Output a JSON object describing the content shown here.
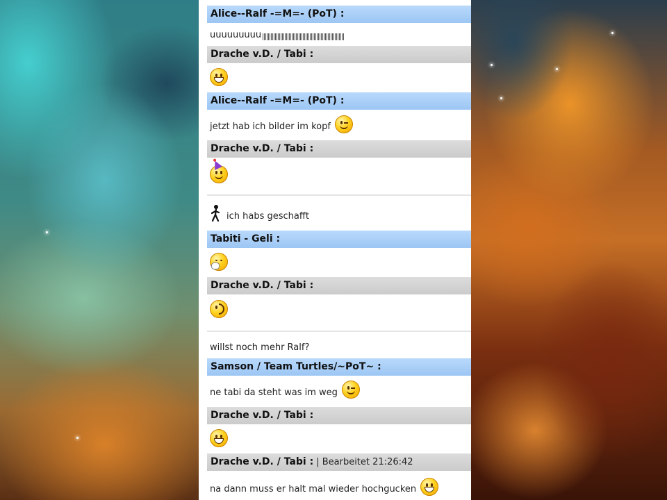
{
  "messages": [
    {
      "type": "header",
      "color": "blue",
      "author": "Alice--Ralf -=M=- (PoT) :"
    },
    {
      "type": "body",
      "text": "uuuuuuuuu"
    },
    {
      "type": "header",
      "color": "gray",
      "author": "Drache v.D. / Tabi :"
    },
    {
      "type": "header",
      "color": "blue",
      "author": "Alice--Ralf -=M=- (PoT) :"
    },
    {
      "type": "body",
      "text": "jetzt hab ich bilder im kopf"
    },
    {
      "type": "header",
      "color": "gray",
      "author": "Drache v.D. / Tabi :"
    },
    {
      "type": "body",
      "text": "ich habs geschafft"
    },
    {
      "type": "header",
      "color": "blue",
      "author": "Tabiti - Geli :"
    },
    {
      "type": "header",
      "color": "gray",
      "author": "Drache v.D. / Tabi :"
    },
    {
      "type": "body",
      "text": "willst noch mehr Ralf?"
    },
    {
      "type": "header",
      "color": "blue",
      "author": "Samson / Team Turtles/~PoT~ :"
    },
    {
      "type": "body",
      "text": "ne tabi da steht was im weg"
    },
    {
      "type": "header",
      "color": "gray",
      "author": "Drache v.D. / Tabi :"
    },
    {
      "type": "header",
      "color": "gray",
      "author": "Drache v.D. / Tabi :",
      "edited": "| Bearbeitet 21:26:42"
    },
    {
      "type": "body",
      "text": "na dann muss er halt mal wieder hochgucken"
    }
  ],
  "icons": {
    "grin": "big-grin-smiley-icon",
    "wink": "wink-smiley-icon",
    "party": "party-smiley-icon",
    "walker": "walking-man-icon",
    "yawn": "yawning-smiley-icon",
    "tongue": "half-face-smiley-icon"
  },
  "colors": {
    "header_blue": "#9cc6f4",
    "header_gray": "#cbcbcb",
    "panel": "#ffffff"
  }
}
